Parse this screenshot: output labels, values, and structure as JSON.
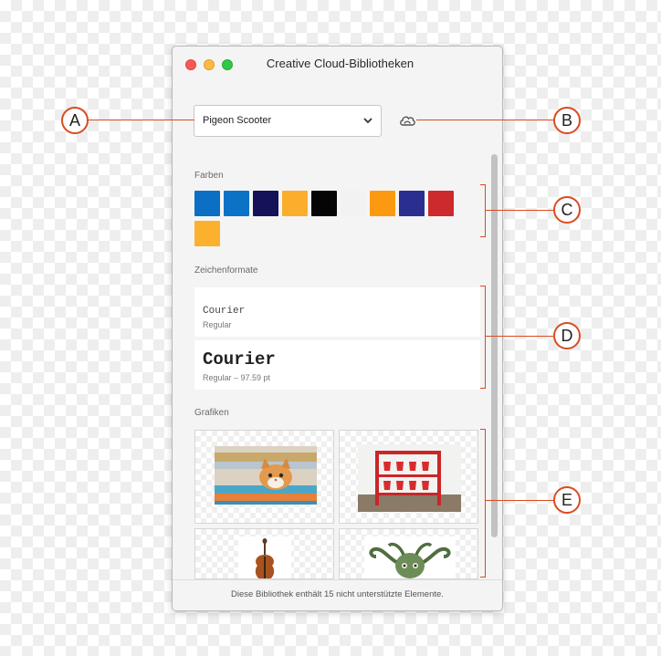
{
  "window": {
    "title": "Creative Cloud-Bibliotheken",
    "traffic_lights": {
      "close": "#fc5753",
      "minimize": "#fdbc40",
      "zoom": "#33c748"
    }
  },
  "library_select": {
    "value": "Pigeon Scooter",
    "icon": "chevron-down-icon"
  },
  "sync_icon": "creative-cloud-icon",
  "sections": {
    "colors": {
      "label": "Farben",
      "swatches": [
        "#0b6fc4",
        "#0c72c6",
        "#141258",
        "#fbae2c",
        "#050505",
        "#f2f2f2",
        "#fb9a10",
        "#2a2f8f",
        "#cc2a2c",
        "#fbb12e"
      ]
    },
    "char_styles": {
      "label": "Zeichenformate",
      "items": [
        {
          "name": "Courier",
          "detail": "Regular"
        },
        {
          "name": "Courier",
          "detail": "Regular – 97.59 pt"
        }
      ]
    },
    "graphics": {
      "label": "Grafiken",
      "items": [
        "kitten-image",
        "fire-buckets-image",
        "violin-image",
        "octopus-image"
      ]
    }
  },
  "footer": {
    "text": "Diese Bibliothek enthält 15 nicht unterstützte Elemente."
  },
  "callouts": {
    "a": "A",
    "b": "B",
    "c": "C",
    "d": "D",
    "e": "E",
    "color": "#d94c22"
  }
}
